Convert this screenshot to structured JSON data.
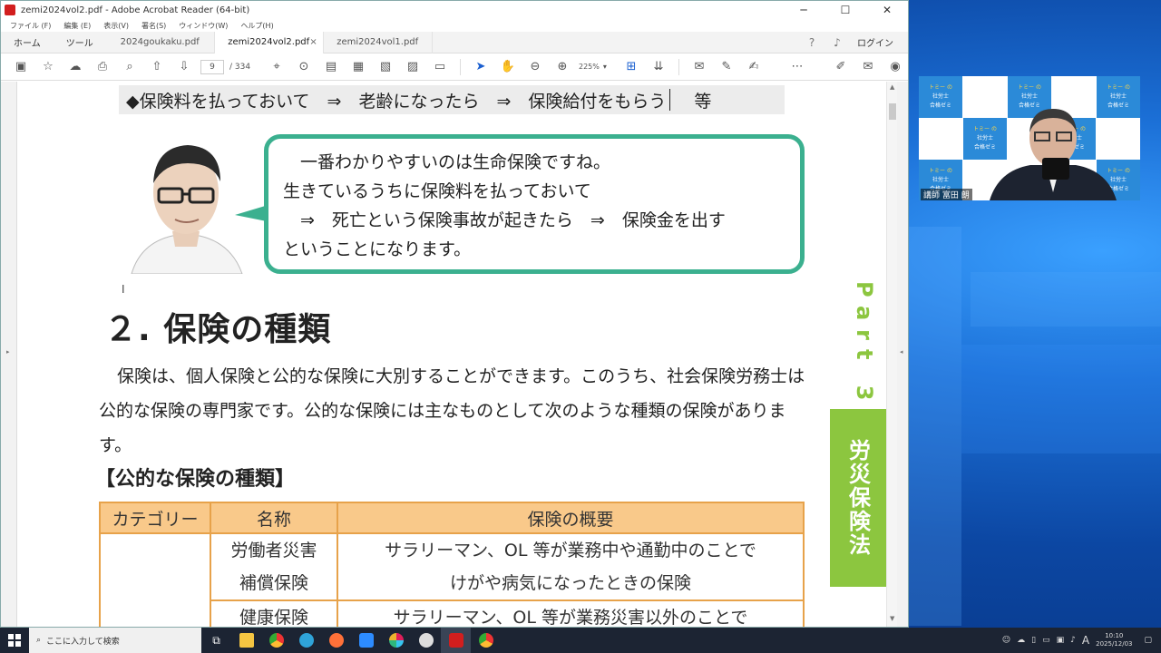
{
  "window": {
    "title": "zemi2024vol2.pdf - Adobe Acrobat Reader (64-bit)",
    "minimize": "─",
    "maximize": "☐",
    "close": "✕"
  },
  "menu": [
    "ファイル (F)",
    "編集 (E)",
    "表示(V)",
    "署名(S)",
    "ウィンドウ(W)",
    "ヘルプ(H)"
  ],
  "tabs": {
    "home": "ホーム",
    "tools": "ツール",
    "docs": [
      {
        "label": "2024goukaku.pdf",
        "active": false
      },
      {
        "label": "zemi2024vol2.pdf",
        "active": true,
        "close": "×"
      },
      {
        "label": "zemi2024vol1.pdf",
        "active": false
      }
    ],
    "login": "ログイン"
  },
  "toolbar": {
    "page_current": "9",
    "page_total": "/ 334",
    "zoom": "225%"
  },
  "document": {
    "topline": "◆保険料を払っておいて　⇒　老齢になったら　⇒　保険給付をもらう",
    "topline_tail": "等",
    "bubble_lines": [
      "　一番わかりやすいのは生命保険ですね。",
      "生きているうちに保険料を払っておいて",
      "　⇒　死亡という保険事故が起きたら　⇒　保険金を出す",
      "ということになります。"
    ],
    "section_title": "２. 保険の種類",
    "paragraph": "保険は、個人保険と公的な保険に大別することができます。このうち、社会保険労務士は公的な保険の専門家です。公的な保険には主なものとして次のような種類の保険があります。",
    "subhead": "【公的な保険の種類】",
    "table": {
      "headers": [
        "カテゴリー",
        "名称",
        "保険の概要"
      ],
      "rows": [
        {
          "category": "",
          "name": [
            "労働者災害",
            "補償保険"
          ],
          "summary": [
            "サラリーマン、OL 等が業務中や通勤中のことで",
            "けがや病気になったときの保険"
          ]
        },
        {
          "category": "",
          "name": [
            "健康保険"
          ],
          "summary": [
            "サラリーマン、OL 等が業務災害以外のことで"
          ]
        }
      ]
    },
    "part_label": "Part 3",
    "chapter_label": "労災保険法"
  },
  "webcam": {
    "tile_line1": "トミー の",
    "tile_line2": "社労士",
    "tile_line3": "合格ゼミ",
    "nameplate": "講師 富田 朗"
  },
  "taskbar": {
    "search_placeholder": "ここに入力して検索",
    "time": "10:10",
    "date": "2025/12/03",
    "ime": "A"
  },
  "colors": {
    "accent_green": "#8cc63f",
    "bubble_border": "#3bb08f",
    "table_header": "#f9c98a",
    "table_border": "#e7a24a",
    "acrobat_red": "#d21e1e"
  }
}
